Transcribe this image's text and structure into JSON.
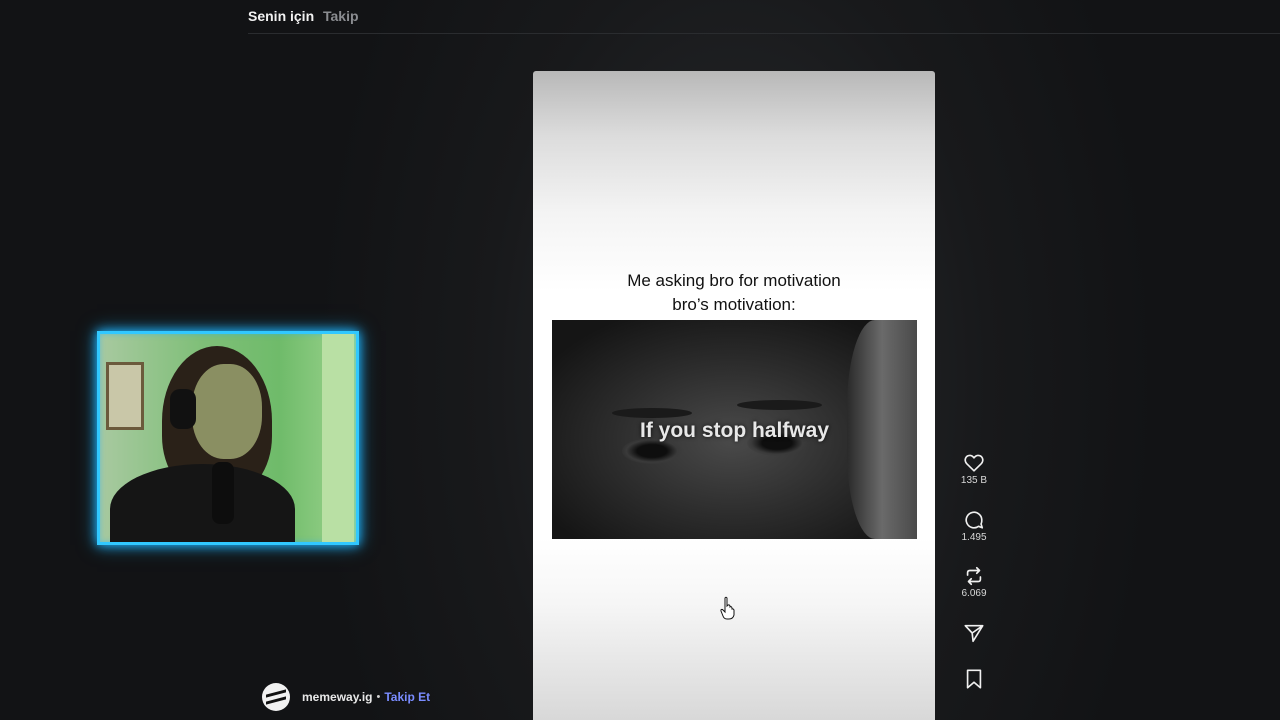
{
  "header": {
    "tabs": [
      {
        "label": "Senin için",
        "active": true
      },
      {
        "label": "Takip",
        "active": false
      }
    ]
  },
  "post": {
    "caption_line1": "Me asking bro for motivation",
    "caption_line2": "bro’s motivation:",
    "clip_overlay_text": "If you stop halfway"
  },
  "actions": {
    "like": {
      "icon": "heart-icon",
      "count": "135 B"
    },
    "comment": {
      "icon": "comment-icon",
      "count": "1.495"
    },
    "repost": {
      "icon": "repost-icon",
      "count": "6.069"
    },
    "share": {
      "icon": "send-icon"
    },
    "save": {
      "icon": "bookmark-icon"
    }
  },
  "author": {
    "username": "memeway.ig",
    "separator": "•",
    "follow_label": "Takip Et"
  },
  "colors": {
    "accent_follow": "#7a8cff",
    "webcam_border": "#31c8ff",
    "background": "#18191b"
  }
}
